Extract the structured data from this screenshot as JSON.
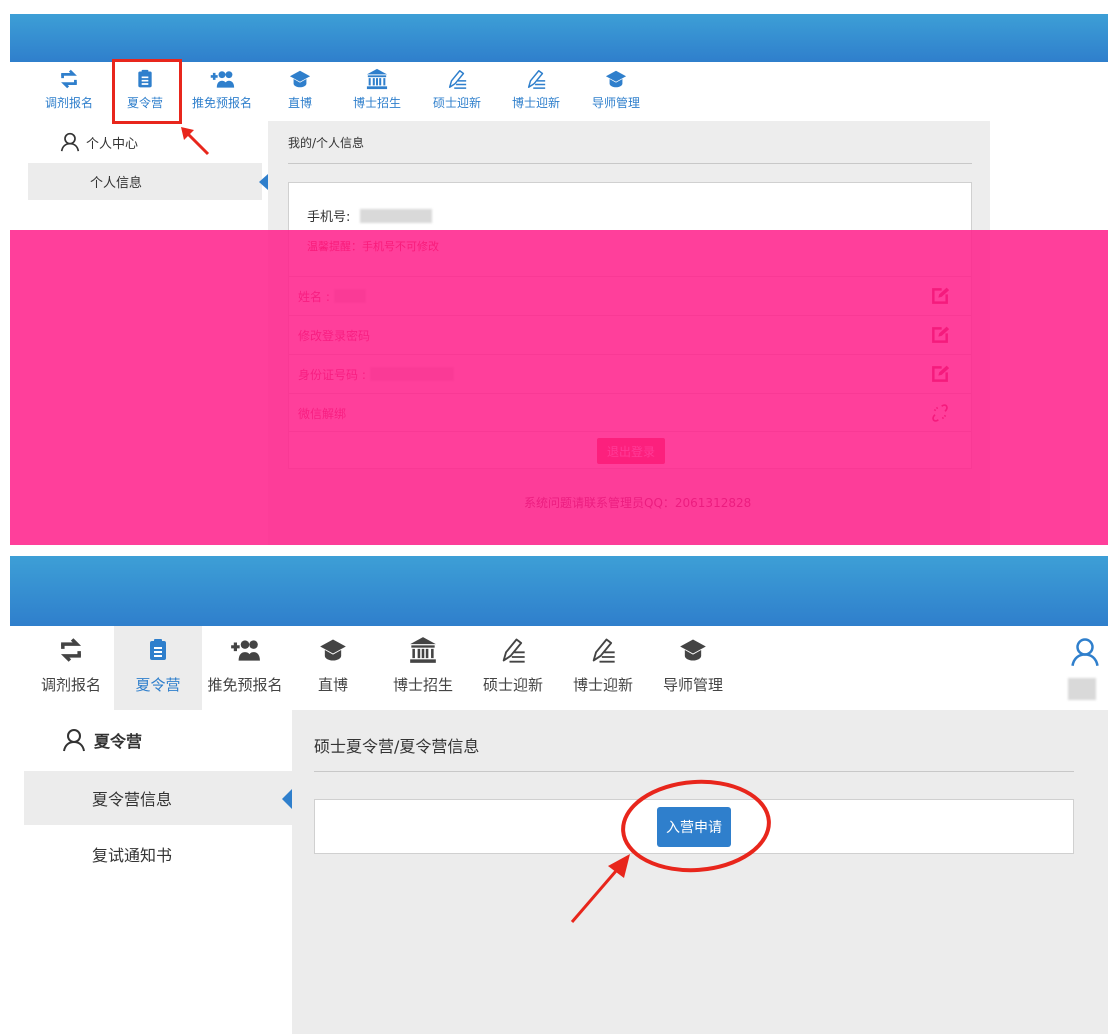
{
  "section1": {
    "nav": [
      {
        "label": "调剂报名",
        "icon": "transfer-icon"
      },
      {
        "label": "夏令营",
        "icon": "document-list-icon"
      },
      {
        "label": "推免预报名",
        "icon": "add-users-icon"
      },
      {
        "label": "直博",
        "icon": "graduation-cap-icon"
      },
      {
        "label": "博士招生",
        "icon": "institution-icon"
      },
      {
        "label": "硕士迎新",
        "icon": "pen-edit-icon"
      },
      {
        "label": "博士迎新",
        "icon": "pen-edit-icon"
      },
      {
        "label": "导师管理",
        "icon": "graduation-cap-icon"
      }
    ],
    "sidebar": {
      "header": "个人中心",
      "items": [
        {
          "label": "个人信息",
          "active": true
        }
      ]
    },
    "breadcrumb": "我的/个人信息",
    "phone_label": "手机号:",
    "phone_hint": "温馨提醒：手机号不可修改",
    "rows": [
      {
        "label": "姓名 :",
        "icon": "edit-icon"
      },
      {
        "label": "修改登录密码",
        "icon": "edit-icon"
      },
      {
        "label": "身份证号码 :",
        "icon": "edit-icon"
      },
      {
        "label": "微信解绑",
        "icon": "unlink-icon"
      }
    ],
    "logout_label": "退出登录",
    "contact_text": "系统问题请联系管理员QQ：2061312828",
    "overlay_color": "#ff1f8a"
  },
  "section2": {
    "nav": [
      {
        "label": "调剂报名",
        "icon": "transfer-icon"
      },
      {
        "label": "夏令营",
        "icon": "document-list-icon",
        "active": true
      },
      {
        "label": "推免预报名",
        "icon": "add-users-icon"
      },
      {
        "label": "直博",
        "icon": "graduation-cap-icon"
      },
      {
        "label": "博士招生",
        "icon": "institution-icon"
      },
      {
        "label": "硕士迎新",
        "icon": "pen-edit-icon"
      },
      {
        "label": "博士迎新",
        "icon": "pen-edit-icon"
      },
      {
        "label": "导师管理",
        "icon": "graduation-cap-icon"
      }
    ],
    "sidebar": {
      "header": "夏令营",
      "items": [
        {
          "label": "夏令营信息",
          "active": true
        },
        {
          "label": "复试通知书"
        }
      ]
    },
    "breadcrumb": "硕士夏令营/夏令营信息",
    "apply_button": "入营申请"
  },
  "colors": {
    "brand_blue": "#2f7fcc",
    "annotation_red": "#e8261c",
    "sidebar_active_bg": "#ececec"
  }
}
